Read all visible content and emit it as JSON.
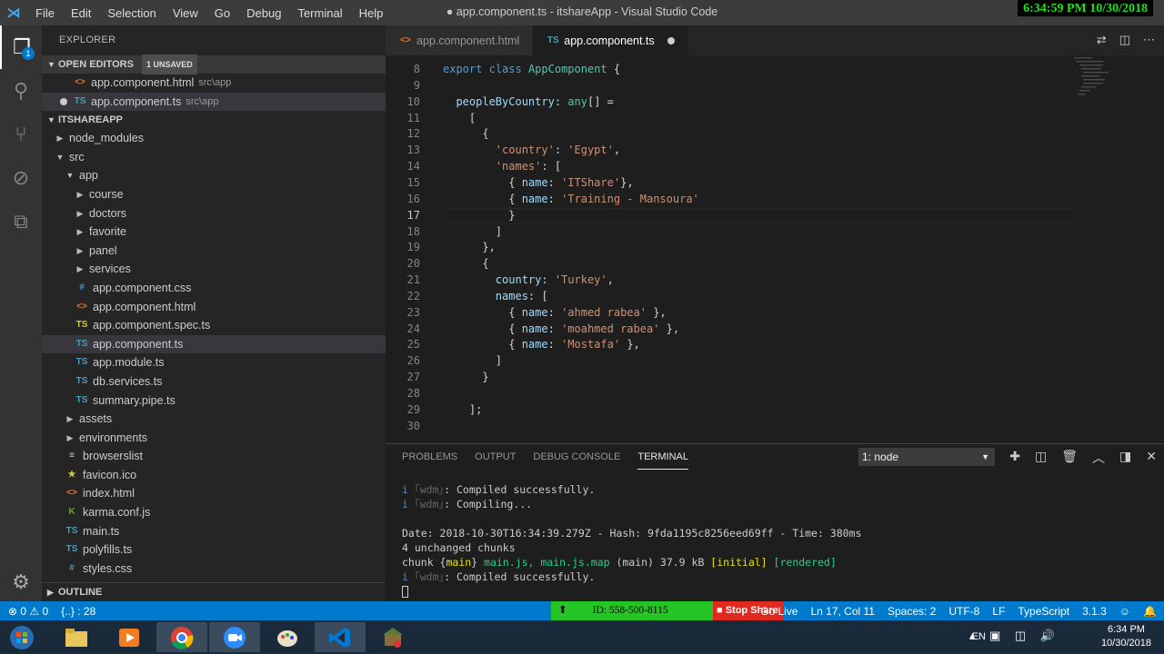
{
  "window": {
    "title": "● app.component.ts - itshareApp - Visual Studio Code",
    "clock": "6:34:59 PM 10/30/2018"
  },
  "menu": [
    "File",
    "Edit",
    "Selection",
    "View",
    "Go",
    "Debug",
    "Terminal",
    "Help"
  ],
  "explorer": {
    "title": "EXPLORER",
    "open_editors_label": "OPEN EDITORS",
    "unsaved_badge": "1 UNSAVED",
    "open_editors": [
      {
        "icon": "html",
        "name": "app.component.html",
        "path": "src\\app"
      },
      {
        "icon": "ts",
        "name": "app.component.ts",
        "path": "src\\app"
      }
    ],
    "project_label": "ITSHAREAPP",
    "tree": [
      {
        "name": "node_modules",
        "type": "folder",
        "level": 0,
        "open": false
      },
      {
        "name": "src",
        "type": "folder",
        "level": 0,
        "open": true
      },
      {
        "name": "app",
        "type": "folder",
        "level": 1,
        "open": true
      },
      {
        "name": "course",
        "type": "folder",
        "level": 2,
        "open": false
      },
      {
        "name": "doctors",
        "type": "folder",
        "level": 2,
        "open": false
      },
      {
        "name": "favorite",
        "type": "folder",
        "level": 2,
        "open": false
      },
      {
        "name": "panel",
        "type": "folder",
        "level": 2,
        "open": false
      },
      {
        "name": "services",
        "type": "folder",
        "level": 2,
        "open": false
      },
      {
        "name": "app.component.css",
        "type": "css",
        "level": 2
      },
      {
        "name": "app.component.html",
        "type": "html",
        "level": 2
      },
      {
        "name": "app.component.spec.ts",
        "type": "tsy",
        "level": 2
      },
      {
        "name": "app.component.ts",
        "type": "ts",
        "level": 2,
        "selected": true
      },
      {
        "name": "app.module.ts",
        "type": "ts",
        "level": 2
      },
      {
        "name": "db.services.ts",
        "type": "ts",
        "level": 2
      },
      {
        "name": "summary.pipe.ts",
        "type": "ts",
        "level": 2
      },
      {
        "name": "assets",
        "type": "folder",
        "level": 1,
        "open": false
      },
      {
        "name": "environments",
        "type": "folder",
        "level": 1,
        "open": false
      },
      {
        "name": "browserslist",
        "type": "file",
        "level": 1
      },
      {
        "name": "favicon.ico",
        "type": "star",
        "level": 1
      },
      {
        "name": "index.html",
        "type": "html",
        "level": 1
      },
      {
        "name": "karma.conf.js",
        "type": "k",
        "level": 1
      },
      {
        "name": "main.ts",
        "type": "ts",
        "level": 1
      },
      {
        "name": "polyfills.ts",
        "type": "ts",
        "level": 1
      },
      {
        "name": "styles.css",
        "type": "css",
        "level": 1
      }
    ],
    "outline_label": "OUTLINE"
  },
  "tabs": [
    {
      "icon": "html",
      "label": "app.component.html",
      "active": false
    },
    {
      "icon": "ts",
      "label": "app.component.ts",
      "active": true,
      "dirty": true
    }
  ],
  "code": {
    "current_line": 17,
    "lines": [
      {
        "n": "8",
        "html": "<span class='kw'>export</span> <span class='kw'>class</span> <span class='cls'>AppComponent</span> {"
      },
      {
        "n": "9",
        "html": ""
      },
      {
        "n": "10",
        "html": "  <span class='prop'>peopleByCountry</span>: <span class='typ'>any</span>[] ="
      },
      {
        "n": "11",
        "html": "    ["
      },
      {
        "n": "12",
        "html": "      {"
      },
      {
        "n": "13",
        "html": "        <span class='str'>'country'</span>: <span class='str'>'Egypt'</span>,"
      },
      {
        "n": "14",
        "html": "        <span class='str'>'names'</span>: ["
      },
      {
        "n": "15",
        "html": "          { <span class='prop'>name</span>: <span class='str'>'ITShare'</span>},"
      },
      {
        "n": "16",
        "html": "          { <span class='prop'>name</span>: <span class='str'>'Training - Mansoura'</span>"
      },
      {
        "n": "17",
        "html": "          }"
      },
      {
        "n": "18",
        "html": "        ]"
      },
      {
        "n": "19",
        "html": "      },"
      },
      {
        "n": "20",
        "html": "      {"
      },
      {
        "n": "21",
        "html": "        <span class='prop'>country</span>: <span class='str'>'Turkey'</span>,"
      },
      {
        "n": "22",
        "html": "        <span class='prop'>names</span>: ["
      },
      {
        "n": "23",
        "html": "          { <span class='prop'>name</span>: <span class='str'>'ahmed rabea'</span> },"
      },
      {
        "n": "24",
        "html": "          { <span class='prop'>name</span>: <span class='str'>'moahmed rabea'</span> },"
      },
      {
        "n": "25",
        "html": "          { <span class='prop'>name</span>: <span class='str'>'Mostafa'</span> },"
      },
      {
        "n": "26",
        "html": "        ]"
      },
      {
        "n": "27",
        "html": "      }"
      },
      {
        "n": "28",
        "html": ""
      },
      {
        "n": "29",
        "html": "    ];"
      },
      {
        "n": "30",
        "html": ""
      }
    ]
  },
  "panel": {
    "tabs": [
      "PROBLEMS",
      "OUTPUT",
      "DEBUG CONSOLE",
      "TERMINAL"
    ],
    "active_tab": "TERMINAL",
    "terminal_select": "1: node",
    "terminal_lines": [
      {
        "html": "<span class='blue'>i</span> <span class='gry'>｢wdm｣</span>: Compiled successfully."
      },
      {
        "html": "<span class='blue'>i</span> <span class='gry'>｢wdm｣</span>: Compiling..."
      },
      {
        "html": ""
      },
      {
        "html": "Date: 2018-10-30T16:34:39.279Z - Hash: 9fda1195c8256eed69ff - Time: 380ms"
      },
      {
        "html": "4 unchanged chunks"
      },
      {
        "html": "chunk {<span class='yel'>main</span>} <span class='grn'>main.js, main.js.map</span> (main) 37.9 kB <span class='yel'>[initial]</span> <span class='grn'>[rendered]</span>"
      },
      {
        "html": "<span class='blue'>i</span> <span class='gry'>｢wdm｣</span>: Compiled successfully."
      }
    ]
  },
  "status": {
    "errors": "0",
    "warnings": "0",
    "braces": "{..} : 28",
    "zoom_id": "ID: 558-500-8115",
    "stop_share": "Stop Share",
    "golive": "Go Live",
    "position": "Ln 17, Col 11",
    "spaces": "Spaces: 2",
    "encoding": "UTF-8",
    "eol": "LF",
    "language": "TypeScript",
    "version": "3.1.3"
  },
  "taskbar": {
    "lang": "EN",
    "time": "6:34 PM",
    "date": "10/30/2018"
  }
}
